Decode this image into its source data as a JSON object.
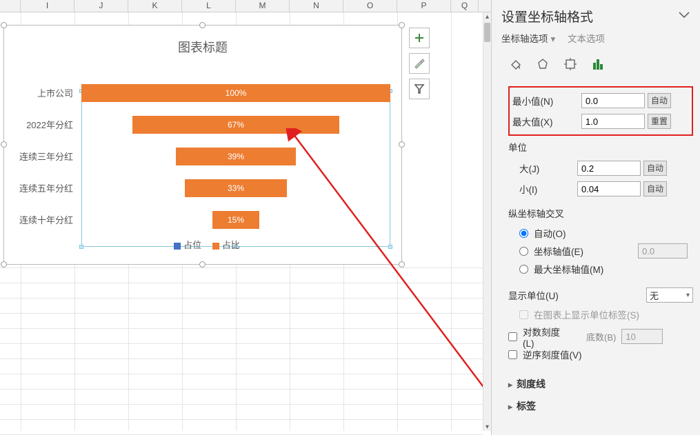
{
  "columns": [
    "I",
    "J",
    "K",
    "L",
    "M",
    "N",
    "O",
    "P",
    "Q"
  ],
  "chart_data": {
    "type": "bar",
    "orientation": "horizontal-centered",
    "title": "图表标题",
    "categories": [
      "上市公司",
      "2022年分红",
      "连续三年分红",
      "连续五年分红",
      "连续十年分红"
    ],
    "values": [
      100,
      67,
      39,
      33,
      15
    ],
    "value_labels": [
      "100%",
      "67%",
      "39%",
      "33%",
      "15%"
    ],
    "legend": [
      "占位",
      "占比"
    ],
    "xlim": [
      0,
      100
    ],
    "series_color": "#ed7d31"
  },
  "sidebuttons": {
    "add": "+",
    "brush": "brush",
    "filter": "filter"
  },
  "panel": {
    "title": "设置坐标轴格式",
    "tab_options": "坐标轴选项",
    "tab_text": "文本选项",
    "bounds": {
      "min_label": "最小值(N)",
      "min_value": "0.0",
      "min_btn": "自动",
      "max_label": "最大值(X)",
      "max_value": "1.0",
      "max_btn": "重置"
    },
    "units": {
      "header": "单位",
      "major_label": "大(J)",
      "major_value": "0.2",
      "major_btn": "自动",
      "minor_label": "小(I)",
      "minor_value": "0.04",
      "minor_btn": "自动"
    },
    "cross": {
      "header": "纵坐标轴交叉",
      "auto": "自动(O)",
      "at_value": "坐标轴值(E)",
      "at_value_num": "0.0",
      "at_max": "最大坐标轴值(M)"
    },
    "display_units": {
      "label": "显示单位(U)",
      "value": "无",
      "show_on_chart": "在图表上显示单位标签(S)"
    },
    "log": {
      "label": "对数刻度(L)",
      "base_label": "底数(B)",
      "base_value": "10"
    },
    "reverse": "逆序刻度值(V)",
    "ticks_header": "刻度线",
    "labels_header": "标签"
  }
}
